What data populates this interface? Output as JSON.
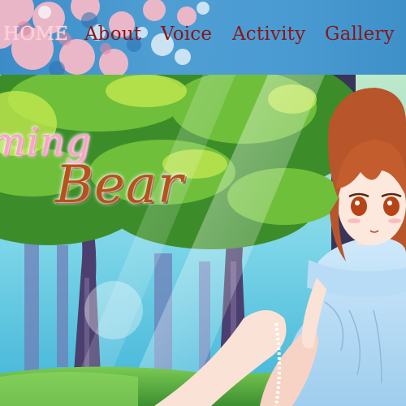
{
  "nav": {
    "items": [
      {
        "label": "HOME",
        "active": true
      },
      {
        "label": "About",
        "active": false
      },
      {
        "label": "Voice",
        "active": false
      },
      {
        "label": "Activity",
        "active": false
      },
      {
        "label": "Gallery",
        "active": false
      }
    ]
  },
  "hero": {
    "logo_line1": "ming",
    "logo_line2": "Bear"
  },
  "colors": {
    "nav_text": "#8c1518",
    "nav_active": "#ffd3dc",
    "header_bg": "#4a9bd2",
    "logo_pink": "#f6a7c4",
    "logo_brown": "#b4531a"
  }
}
